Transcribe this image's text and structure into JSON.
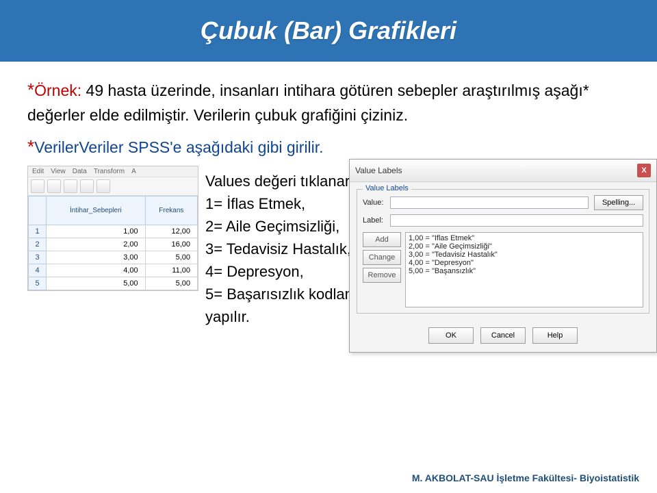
{
  "title": "Çubuk (Bar) Grafikleri",
  "para1_star": "*",
  "para1_ornek": "Örnek:",
  "para1_rest": " 49 hasta üzerinde, insanları intihara götüren sebepler araştırılmış aşağı* değerler elde edilmiştir. Verilerin çubuk grafiğini çiziniz.",
  "para2_star": "*",
  "para2_text": "VerilerVeriler SPSS'e aşağıdaki gibi girilir.",
  "spss_menu": [
    "Edit",
    "View",
    "Data",
    "Transform",
    "A"
  ],
  "spss_headers": [
    "",
    "İntihar_Sebepleri",
    "Frekans"
  ],
  "spss_rows": [
    [
      "1",
      "1,00",
      "12,00"
    ],
    [
      "2",
      "2,00",
      "16,00"
    ],
    [
      "3",
      "3,00",
      "5,00"
    ],
    [
      "4",
      "4,00",
      "11,00"
    ],
    [
      "5",
      "5,00",
      "5,00"
    ]
  ],
  "center_text": "Values değeri tıklanarak\n1= İflas Etmek,\n2= Aile Geçimsizliği,\n3= Tedavisiz Hastalık,\n4= Depresyon,\n5= Başarısızlık kodlaması yapılır.",
  "dialog": {
    "title": "Value Labels",
    "group": "Value Labels",
    "value_label": "Value:",
    "label_label": "Label:",
    "spelling": "Spelling...",
    "add": "Add",
    "change": "Change",
    "remove": "Remove",
    "items": [
      "1,00 = \"Iflas Etmek\"",
      "2,00 = \"Aile Geçimsizliği\"",
      "3,00 = \"Tedavisiz Hastalık\"",
      "4,00 = \"Depresyon\"",
      "5,00 = \"Başansızlık\""
    ],
    "ok": "OK",
    "cancel": "Cancel",
    "help": "Help"
  },
  "footer": "M. AKBOLAT-SAU İşletme Fakültesi- Biyoistatistik"
}
